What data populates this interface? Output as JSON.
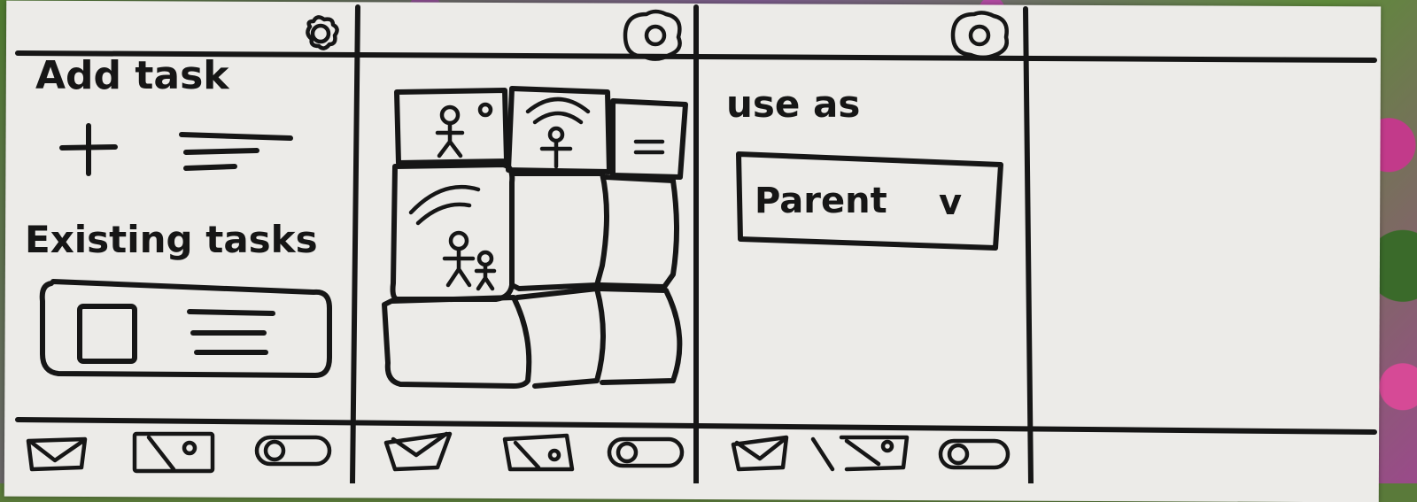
{
  "screen1": {
    "add_task_label": "Add task",
    "existing_tasks_label": "Existing tasks",
    "settings_icon": "gear-icon",
    "add_icon": "plus-icon",
    "task_text_icon": "lines-icon",
    "task_checkbox_icon": "checkbox-icon"
  },
  "screen2": {
    "settings_icon": "gear-icon",
    "tiles": [
      "person-tile",
      "wifi-person-tile",
      "menu-tile",
      "family-wifi-tile"
    ]
  },
  "screen3": {
    "settings_icon": "gear-icon",
    "use_as_label": "use as",
    "role_dropdown_value": "Parent",
    "dropdown_arrow": "v"
  },
  "bottom_nav": {
    "items": [
      "tasks-icon",
      "photo-icon",
      "toggle-icon"
    ]
  }
}
